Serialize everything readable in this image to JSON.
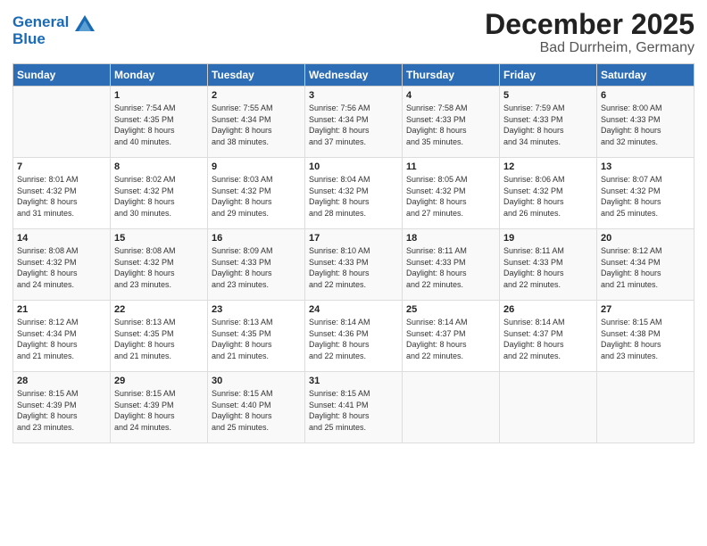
{
  "header": {
    "logo_line1": "General",
    "logo_line2": "Blue",
    "title": "December 2025",
    "subtitle": "Bad Durrheim, Germany"
  },
  "days_of_week": [
    "Sunday",
    "Monday",
    "Tuesday",
    "Wednesday",
    "Thursday",
    "Friday",
    "Saturday"
  ],
  "weeks": [
    [
      {
        "day": "",
        "info": ""
      },
      {
        "day": "1",
        "info": "Sunrise: 7:54 AM\nSunset: 4:35 PM\nDaylight: 8 hours\nand 40 minutes."
      },
      {
        "day": "2",
        "info": "Sunrise: 7:55 AM\nSunset: 4:34 PM\nDaylight: 8 hours\nand 38 minutes."
      },
      {
        "day": "3",
        "info": "Sunrise: 7:56 AM\nSunset: 4:34 PM\nDaylight: 8 hours\nand 37 minutes."
      },
      {
        "day": "4",
        "info": "Sunrise: 7:58 AM\nSunset: 4:33 PM\nDaylight: 8 hours\nand 35 minutes."
      },
      {
        "day": "5",
        "info": "Sunrise: 7:59 AM\nSunset: 4:33 PM\nDaylight: 8 hours\nand 34 minutes."
      },
      {
        "day": "6",
        "info": "Sunrise: 8:00 AM\nSunset: 4:33 PM\nDaylight: 8 hours\nand 32 minutes."
      }
    ],
    [
      {
        "day": "7",
        "info": "Sunrise: 8:01 AM\nSunset: 4:32 PM\nDaylight: 8 hours\nand 31 minutes."
      },
      {
        "day": "8",
        "info": "Sunrise: 8:02 AM\nSunset: 4:32 PM\nDaylight: 8 hours\nand 30 minutes."
      },
      {
        "day": "9",
        "info": "Sunrise: 8:03 AM\nSunset: 4:32 PM\nDaylight: 8 hours\nand 29 minutes."
      },
      {
        "day": "10",
        "info": "Sunrise: 8:04 AM\nSunset: 4:32 PM\nDaylight: 8 hours\nand 28 minutes."
      },
      {
        "day": "11",
        "info": "Sunrise: 8:05 AM\nSunset: 4:32 PM\nDaylight: 8 hours\nand 27 minutes."
      },
      {
        "day": "12",
        "info": "Sunrise: 8:06 AM\nSunset: 4:32 PM\nDaylight: 8 hours\nand 26 minutes."
      },
      {
        "day": "13",
        "info": "Sunrise: 8:07 AM\nSunset: 4:32 PM\nDaylight: 8 hours\nand 25 minutes."
      }
    ],
    [
      {
        "day": "14",
        "info": "Sunrise: 8:08 AM\nSunset: 4:32 PM\nDaylight: 8 hours\nand 24 minutes."
      },
      {
        "day": "15",
        "info": "Sunrise: 8:08 AM\nSunset: 4:32 PM\nDaylight: 8 hours\nand 23 minutes."
      },
      {
        "day": "16",
        "info": "Sunrise: 8:09 AM\nSunset: 4:33 PM\nDaylight: 8 hours\nand 23 minutes."
      },
      {
        "day": "17",
        "info": "Sunrise: 8:10 AM\nSunset: 4:33 PM\nDaylight: 8 hours\nand 22 minutes."
      },
      {
        "day": "18",
        "info": "Sunrise: 8:11 AM\nSunset: 4:33 PM\nDaylight: 8 hours\nand 22 minutes."
      },
      {
        "day": "19",
        "info": "Sunrise: 8:11 AM\nSunset: 4:33 PM\nDaylight: 8 hours\nand 22 minutes."
      },
      {
        "day": "20",
        "info": "Sunrise: 8:12 AM\nSunset: 4:34 PM\nDaylight: 8 hours\nand 21 minutes."
      }
    ],
    [
      {
        "day": "21",
        "info": "Sunrise: 8:12 AM\nSunset: 4:34 PM\nDaylight: 8 hours\nand 21 minutes."
      },
      {
        "day": "22",
        "info": "Sunrise: 8:13 AM\nSunset: 4:35 PM\nDaylight: 8 hours\nand 21 minutes."
      },
      {
        "day": "23",
        "info": "Sunrise: 8:13 AM\nSunset: 4:35 PM\nDaylight: 8 hours\nand 21 minutes."
      },
      {
        "day": "24",
        "info": "Sunrise: 8:14 AM\nSunset: 4:36 PM\nDaylight: 8 hours\nand 22 minutes."
      },
      {
        "day": "25",
        "info": "Sunrise: 8:14 AM\nSunset: 4:37 PM\nDaylight: 8 hours\nand 22 minutes."
      },
      {
        "day": "26",
        "info": "Sunrise: 8:14 AM\nSunset: 4:37 PM\nDaylight: 8 hours\nand 22 minutes."
      },
      {
        "day": "27",
        "info": "Sunrise: 8:15 AM\nSunset: 4:38 PM\nDaylight: 8 hours\nand 23 minutes."
      }
    ],
    [
      {
        "day": "28",
        "info": "Sunrise: 8:15 AM\nSunset: 4:39 PM\nDaylight: 8 hours\nand 23 minutes."
      },
      {
        "day": "29",
        "info": "Sunrise: 8:15 AM\nSunset: 4:39 PM\nDaylight: 8 hours\nand 24 minutes."
      },
      {
        "day": "30",
        "info": "Sunrise: 8:15 AM\nSunset: 4:40 PM\nDaylight: 8 hours\nand 25 minutes."
      },
      {
        "day": "31",
        "info": "Sunrise: 8:15 AM\nSunset: 4:41 PM\nDaylight: 8 hours\nand 25 minutes."
      },
      {
        "day": "",
        "info": ""
      },
      {
        "day": "",
        "info": ""
      },
      {
        "day": "",
        "info": ""
      }
    ]
  ]
}
